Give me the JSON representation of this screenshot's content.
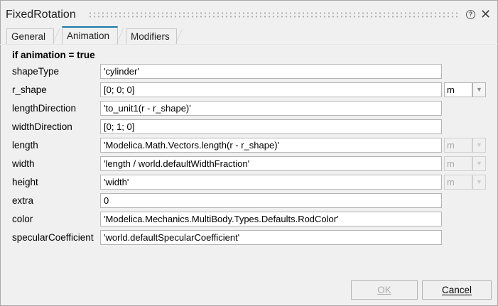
{
  "window": {
    "title": "FixedRotation",
    "help_icon": "help-circle-icon",
    "close_icon": "close-icon"
  },
  "tabs": [
    {
      "label": "General"
    },
    {
      "label": "Animation",
      "selected": true
    },
    {
      "label": "Modifiers"
    }
  ],
  "section_heading": "if animation = true",
  "params": [
    {
      "label": "shapeType",
      "value": "'cylinder'"
    },
    {
      "label": "r_shape",
      "value": "[0; 0; 0]",
      "unit": "m",
      "unit_enabled": true
    },
    {
      "label": "lengthDirection",
      "value": "'to_unit1(r - r_shape)'"
    },
    {
      "label": "widthDirection",
      "value": "[0; 1; 0]"
    },
    {
      "label": "length",
      "value": "'Modelica.Math.Vectors.length(r - r_shape)'",
      "unit": "m",
      "unit_enabled": false
    },
    {
      "label": "width",
      "value": "'length / world.defaultWidthFraction'",
      "unit": "m",
      "unit_enabled": false
    },
    {
      "label": "height",
      "value": "'width'",
      "unit": "m",
      "unit_enabled": false
    },
    {
      "label": "extra",
      "value": "0"
    },
    {
      "label": "color",
      "value": "'Modelica.Mechanics.MultiBody.Types.Defaults.RodColor'"
    },
    {
      "label": "specularCoefficient",
      "value": "'world.defaultSpecularCoefficient'"
    }
  ],
  "buttons": {
    "ok": "OK",
    "cancel": "Cancel",
    "ok_enabled": false
  },
  "colors": {
    "accent": "#1a7aa8"
  }
}
